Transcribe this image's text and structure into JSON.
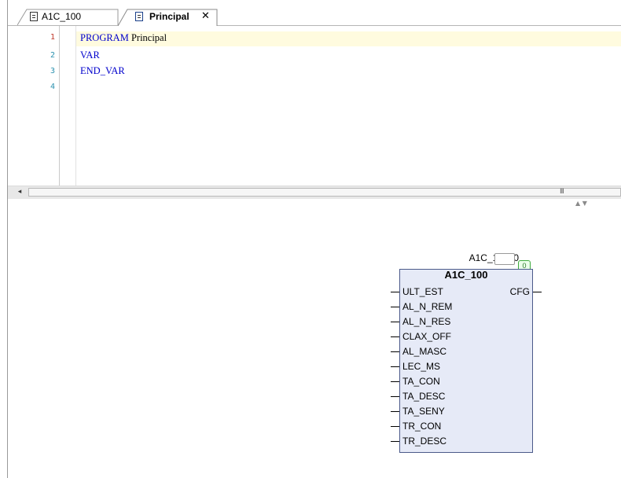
{
  "tabs": [
    {
      "label": "A1C_100",
      "active": false,
      "icon": "document-icon"
    },
    {
      "label": "Principal",
      "active": true,
      "icon": "program-icon",
      "close_glyph": "✕"
    }
  ],
  "editor": {
    "lines": [
      {
        "number": "1",
        "tokens": [
          {
            "text": "PROGRAM ",
            "kind": "keyword"
          },
          {
            "text": "Principal",
            "kind": "identifier"
          }
        ]
      },
      {
        "number": "2",
        "tokens": [
          {
            "text": "VAR",
            "kind": "keyword"
          }
        ]
      },
      {
        "number": "3",
        "tokens": [
          {
            "text": "END_VAR",
            "kind": "keyword"
          }
        ]
      },
      {
        "number": "4",
        "tokens": []
      }
    ],
    "colors": {
      "keyword": "#0000cc",
      "identifier": "#000000",
      "line_number": "#2b91af",
      "current_line": "#fffbdf"
    }
  },
  "scrollbar": {
    "left_arrow": "◂",
    "grip": "III",
    "splitter_arrows": "▲ ▼"
  },
  "fbd": {
    "instance_name": "A1C_100_0",
    "execution_order": "0",
    "block_type": "A1C_100",
    "inputs": [
      "ULT_EST",
      "AL_N_REM",
      "AL_N_RES",
      "CLAX_OFF",
      "AL_MASC",
      "LEC_MS",
      "TA_CON",
      "TA_DESC",
      "TA_SENY",
      "TR_CON",
      "TR_DESC"
    ],
    "outputs": [
      "CFG"
    ],
    "colors": {
      "block_fill": "#e6eaf7",
      "block_border": "#4b5a8a",
      "exec_badge": "#3daa3d"
    }
  }
}
